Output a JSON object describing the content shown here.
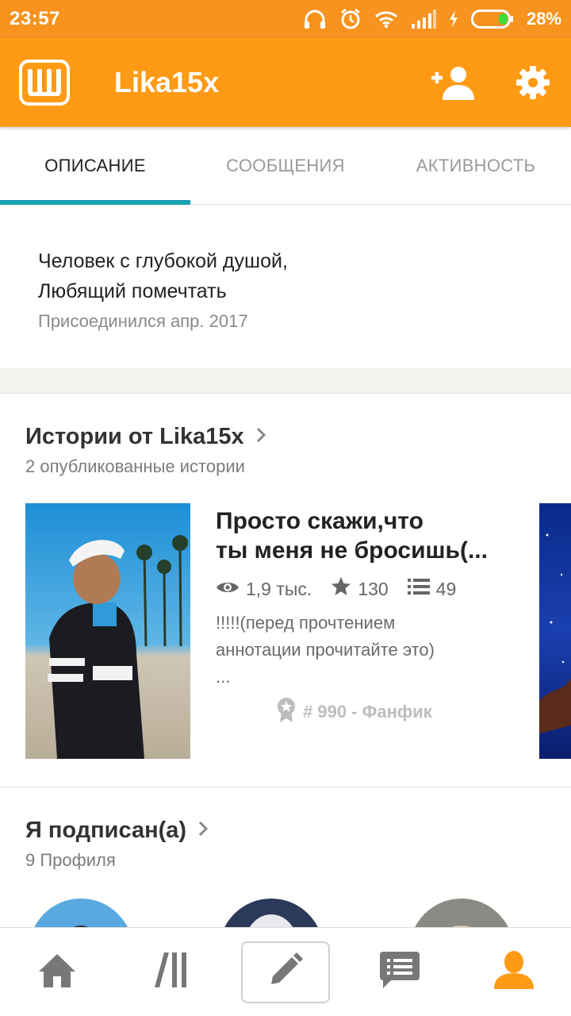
{
  "status_bar": {
    "time": "23:57",
    "battery_percent": "28%",
    "icons": [
      "headphones-icon",
      "alarm-icon",
      "wifi-icon",
      "signal-icon",
      "charging-icon",
      "battery-icon"
    ]
  },
  "app_bar": {
    "logo_icon": "wattpad-logo-icon",
    "title": "Lika15x",
    "actions": [
      "add-friend-icon",
      "settings-gear-icon"
    ],
    "color": "#ff9a14"
  },
  "tabs": [
    {
      "label": "ОПИСАНИЕ",
      "active": true
    },
    {
      "label": "СООБЩЕНИЯ",
      "active": false
    },
    {
      "label": "АКТИВНОСТЬ",
      "active": false
    }
  ],
  "description": {
    "line1": "Человек с глубокой душой,",
    "line2": "Любящий помечтать",
    "joined": "Присоединился апр. 2017"
  },
  "stories_section": {
    "title": "Истории от Lika15x",
    "subtitle": "2 опубликованные истории",
    "story": {
      "title_line1": "Просто скажи,что",
      "title_line2": "ты меня не бросишь(...",
      "reads": "1,9 тыс.",
      "votes": "130",
      "parts": "49",
      "desc_line1": "!!!!!(перед прочтением",
      "desc_line2": "аннотации прочитайте это)",
      "desc_line3": "...",
      "rank": "# 990 - Фанфик"
    }
  },
  "following_section": {
    "title": "Я подписан(а)",
    "subtitle": "9 Профиля"
  },
  "bottom_nav": [
    "home-icon",
    "library-icon",
    "write-pencil-icon",
    "messages-icon",
    "profile-icon"
  ],
  "colors": {
    "accent": "#ff9a14",
    "tab_indicator": "#1aa0b2"
  }
}
